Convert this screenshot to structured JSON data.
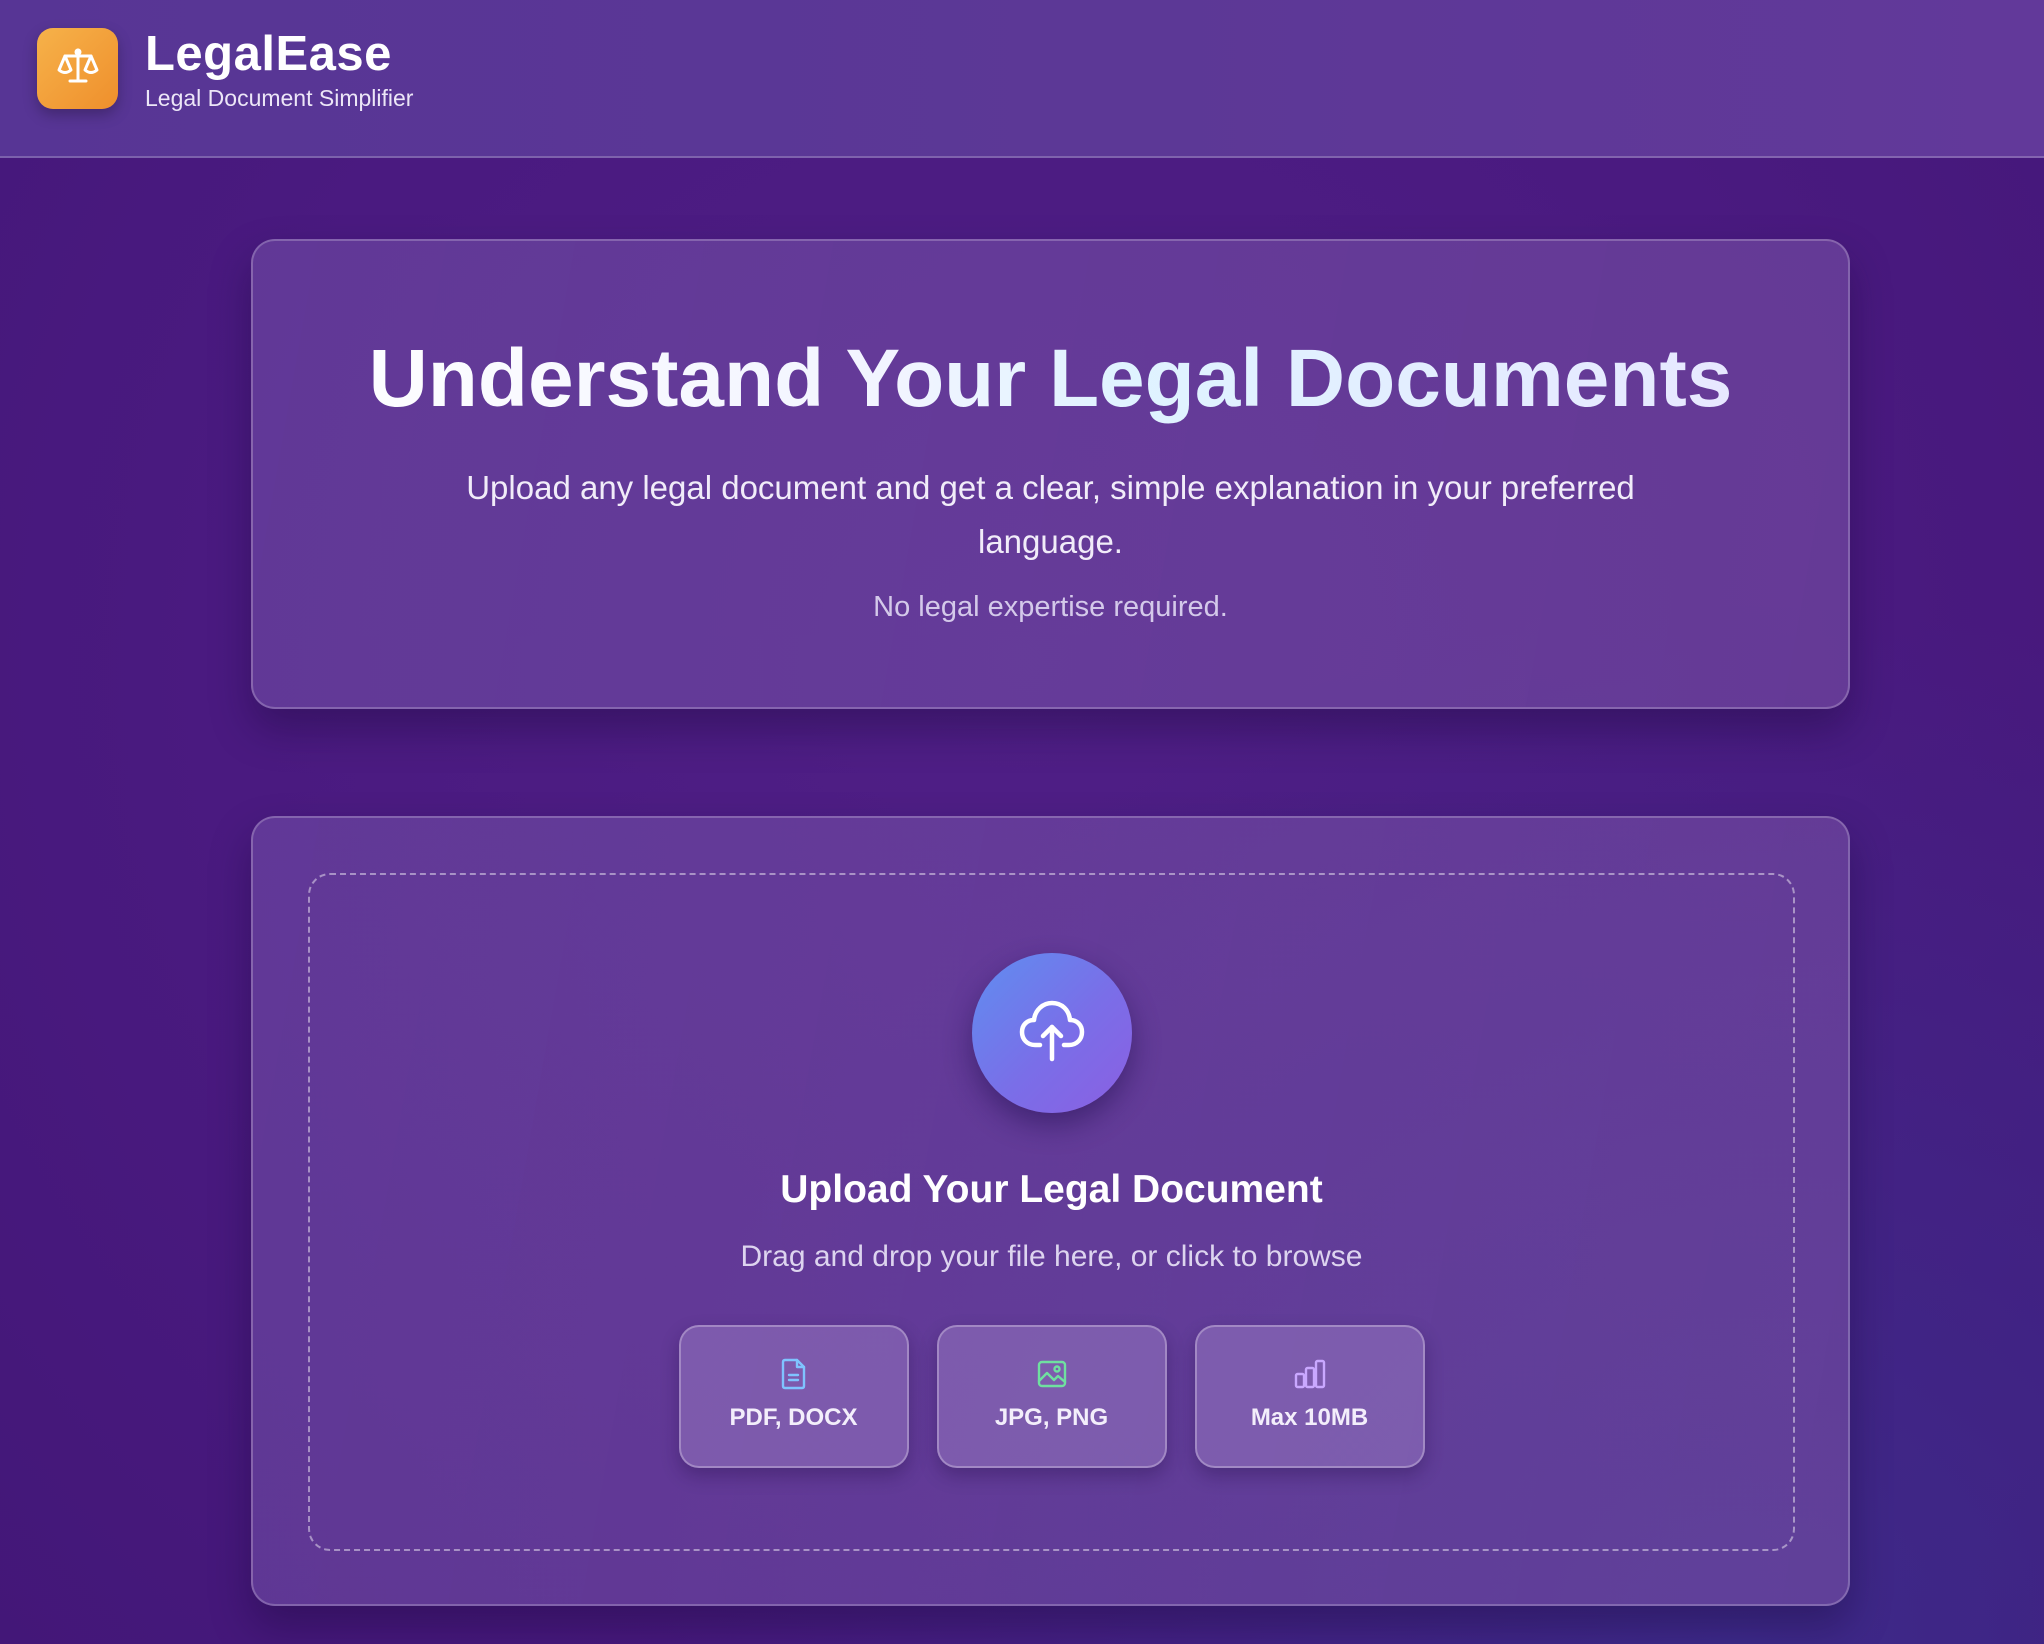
{
  "header": {
    "logo_icon": "scales-icon",
    "title": "LegalEase",
    "subtitle": "Legal Document Simplifier"
  },
  "hero": {
    "title": "Understand Your Legal Documents",
    "description": "Upload any legal document and get a clear, simple explanation in your preferred language.",
    "note": "No legal expertise required."
  },
  "upload": {
    "icon": "cloud-upload-icon",
    "title": "Upload Your Legal Document",
    "subtitle": "Drag and drop your file here, or click to browse",
    "chips": [
      {
        "icon": "document-icon",
        "label": "PDF, DOCX",
        "color": "#7fc3ff"
      },
      {
        "icon": "image-icon",
        "label": "JPG, PNG",
        "color": "#6fe0a0"
      },
      {
        "icon": "bar-chart-icon",
        "label": "Max 10MB",
        "color": "#c9a8ff"
      }
    ]
  },
  "colors": {
    "brand_accent": "#f29a36",
    "upload_gradient_start": "#5f8ef0",
    "upload_gradient_end": "#8b5fe2",
    "background": "#4a1a80"
  }
}
